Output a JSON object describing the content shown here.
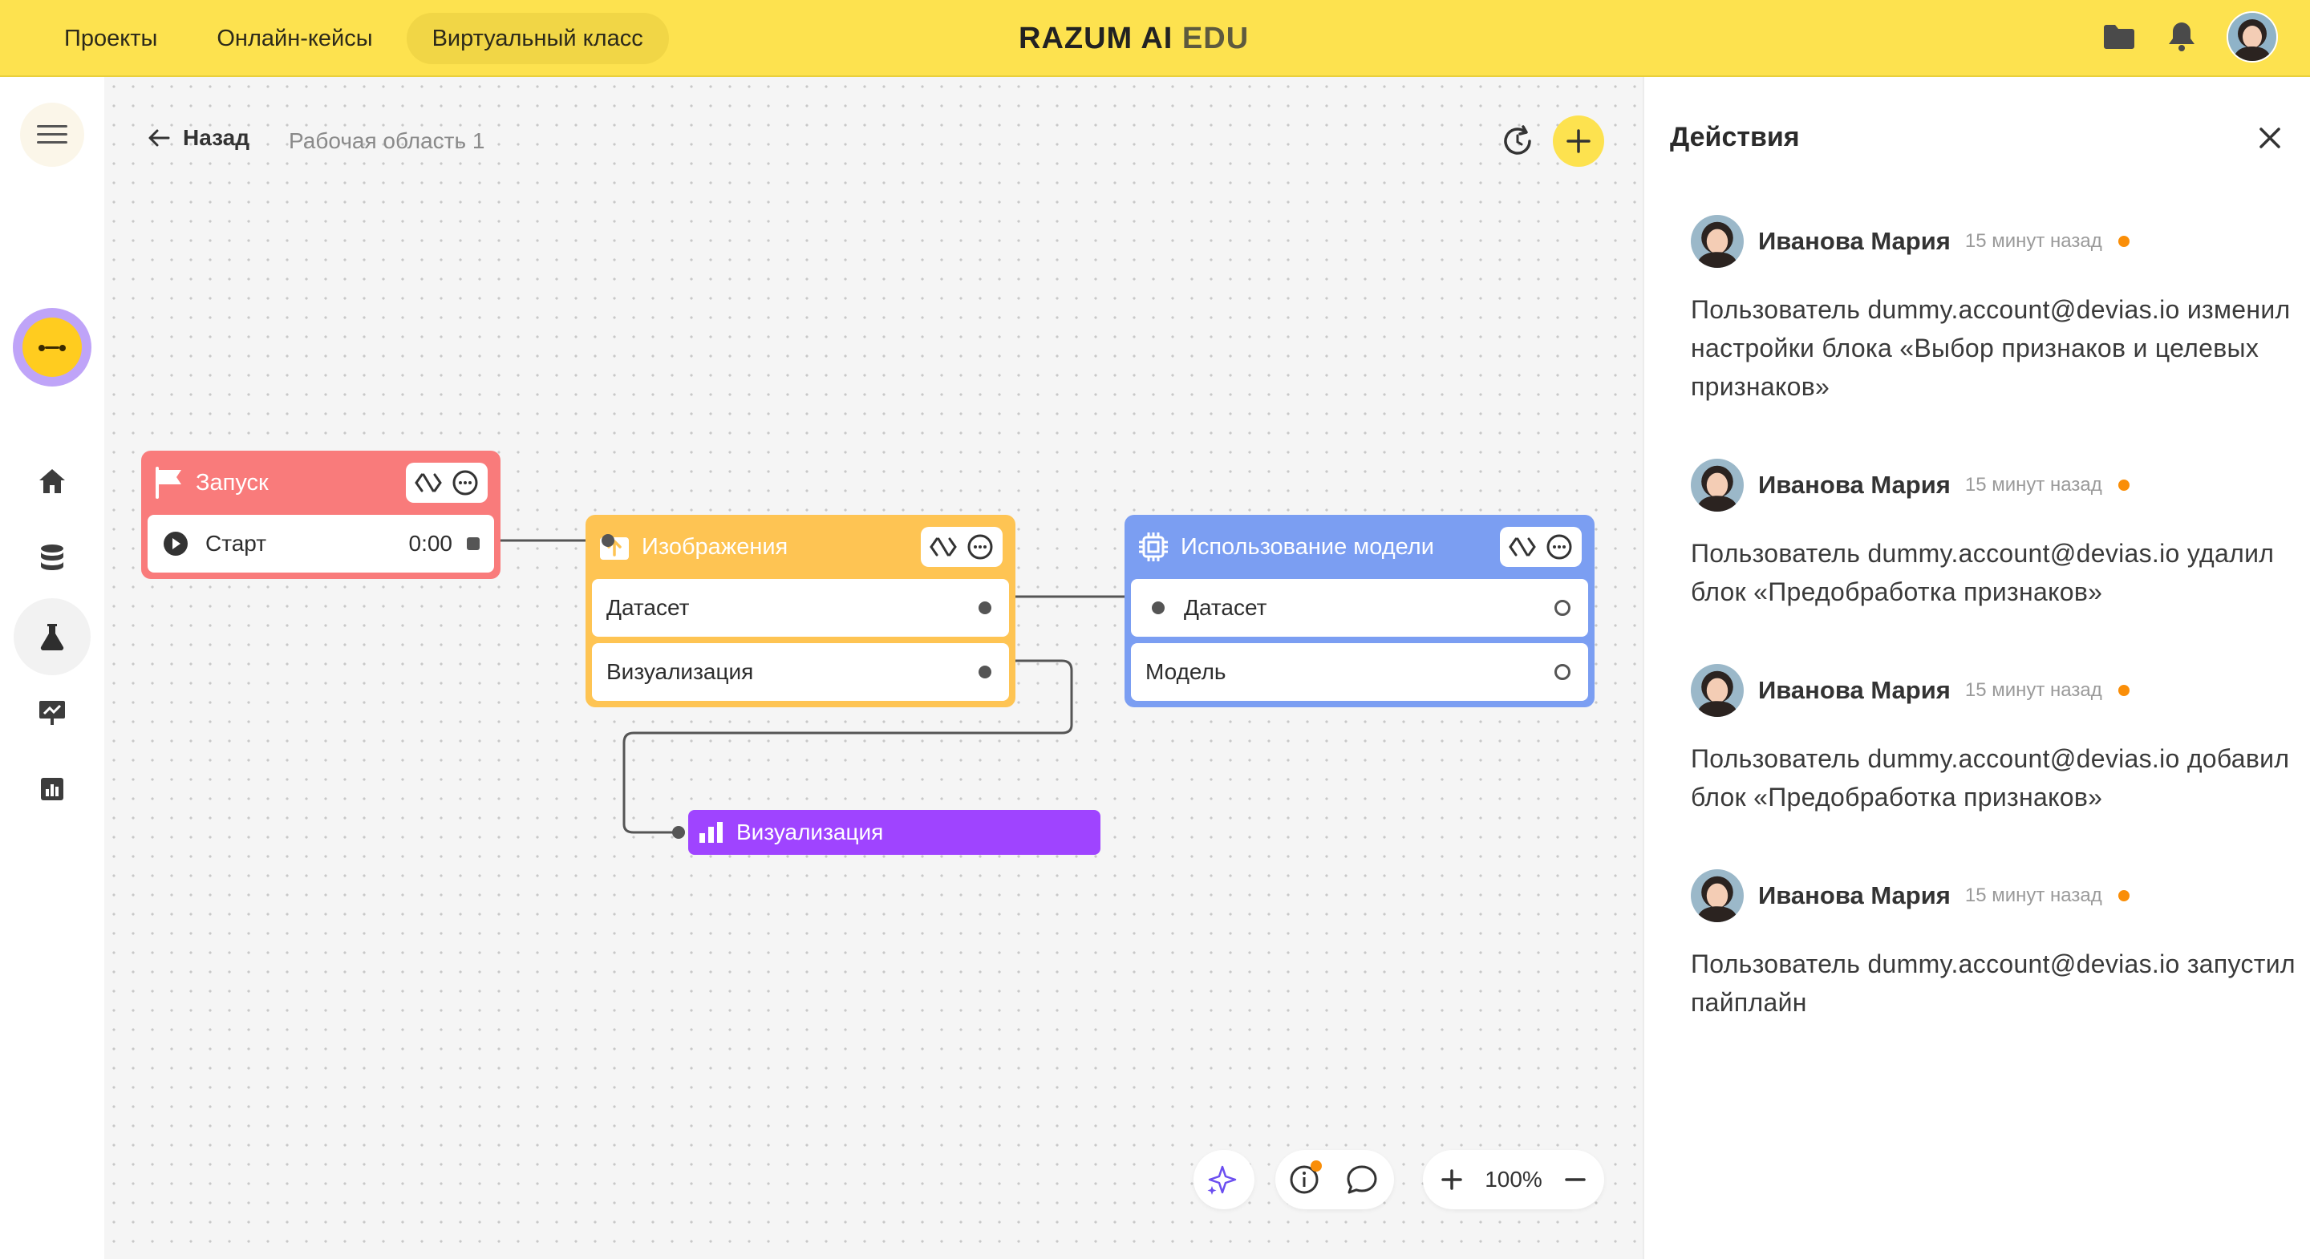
{
  "topnav": {
    "tabs": [
      {
        "label": "Проекты"
      },
      {
        "label": "Онлайн-кейсы"
      },
      {
        "label": "Виртуальный класс",
        "active": true
      }
    ],
    "logo_main": "RAZUM AI",
    "logo_edu": "EDU",
    "icons": [
      "folder-icon",
      "bell-icon",
      "user-avatar"
    ]
  },
  "sidebar": {
    "items": [
      "menu-icon",
      "bot-avatar",
      "home-icon",
      "database-icon",
      "flask-icon",
      "presentation-icon",
      "chart-icon"
    ],
    "active": "flask-icon"
  },
  "workspace": {
    "back_label": "Назад",
    "name": "Рабочая область 1",
    "zoom": "100%"
  },
  "nodes": {
    "run": {
      "title": "Запуск",
      "row_label": "Старт",
      "row_time": "0:00",
      "color": "#f97b7b"
    },
    "images": {
      "title": "Изображения",
      "rows": [
        "Датасет",
        "Визуализация"
      ],
      "color": "#fec453"
    },
    "model": {
      "title": "Использование модели",
      "rows": [
        "Датасет",
        "Модель"
      ],
      "color": "#7b9ef2"
    },
    "viz": {
      "title": "Визуализация",
      "color": "#9f44ff"
    }
  },
  "panel": {
    "title": "Действия",
    "activities": [
      {
        "user": "Иванова Мария",
        "time": "15 минут назад",
        "text": "Пользователь dummy.account@devias.io изменил настройки блока «Выбор признаков и целевых признаков»"
      },
      {
        "user": "Иванова Мария",
        "time": "15 минут назад",
        "text": "Пользователь dummy.account@devias.io удалил блок «Предобработка признаков»"
      },
      {
        "user": "Иванова Мария",
        "time": "15 минут назад",
        "text": "Пользователь dummy.account@devias.io добавил блок «Предобработка признаков»"
      },
      {
        "user": "Иванова Мария",
        "time": "15 минут назад",
        "text": "Пользователь dummy.account@devias.io запустил пайплайн"
      }
    ]
  },
  "colors": {
    "accent_yellow": "#fde24f",
    "status_dot": "#fa8e08"
  }
}
